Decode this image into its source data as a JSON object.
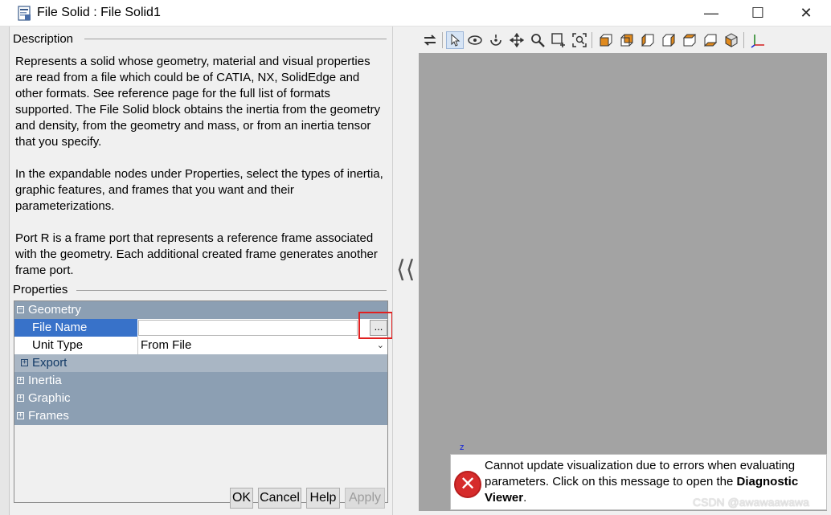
{
  "window": {
    "title": "File Solid : File Solid1",
    "minimize": "—",
    "maximize": "☐",
    "close": "✕"
  },
  "description": {
    "heading": "Description",
    "paragraphs": [
      "Represents a solid whose geometry, material and visual properties are read from a file which could be of CATIA, NX, SolidEdge and other formats. See reference page for the full list of formats supported. The File Solid block obtains the inertia from the geometry and density, from the geometry and mass, or from an inertia tensor that you specify.",
      "In the expandable nodes under Properties, select the types of inertia, graphic features, and frames that you want and their parameterizations.",
      "Port R is a frame port that represents a reference frame associated with the geometry. Each additional created frame generates another frame port."
    ]
  },
  "properties": {
    "heading": "Properties",
    "geometry": {
      "label": "Geometry",
      "toggle": "−",
      "file_name_label": "File Name",
      "file_name_value": "",
      "browse_label": "...",
      "unit_type_label": "Unit Type",
      "unit_type_value": "From File",
      "export_label": "Export",
      "export_toggle": "+"
    },
    "inertia": {
      "label": "Inertia",
      "toggle": "+"
    },
    "graphic": {
      "label": "Graphic",
      "toggle": "+"
    },
    "frames": {
      "label": "Frames",
      "toggle": "+"
    }
  },
  "buttons": {
    "ok": "OK",
    "cancel": "Cancel",
    "help": "Help",
    "apply": "Apply"
  },
  "toolbar": {
    "icons": [
      "swap-icon",
      "select-arrow-icon",
      "rotate-icon",
      "roll-icon",
      "pan-icon",
      "zoom-icon",
      "zoom-box-icon",
      "fit-to-view-icon",
      "front-view-icon",
      "back-view-icon",
      "left-view-icon",
      "right-view-icon",
      "top-view-icon",
      "bottom-view-icon",
      "isometric-view-icon",
      "axes-icon"
    ]
  },
  "viewport": {
    "axis_label": "z"
  },
  "error": {
    "message_prefix": "Cannot update visualization due to errors when evaluating parameters. Click on this message to open the ",
    "link_text": "Diagnostic Viewer",
    "message_suffix": "."
  },
  "watermark": "CSDN @awawaawawa",
  "colors": {
    "section_header": "#8c9fb3",
    "selected_row": "#3872c9",
    "viewport": "#a3a3a3",
    "error_red": "#d62b2b",
    "highlight_box": "#e02020"
  }
}
